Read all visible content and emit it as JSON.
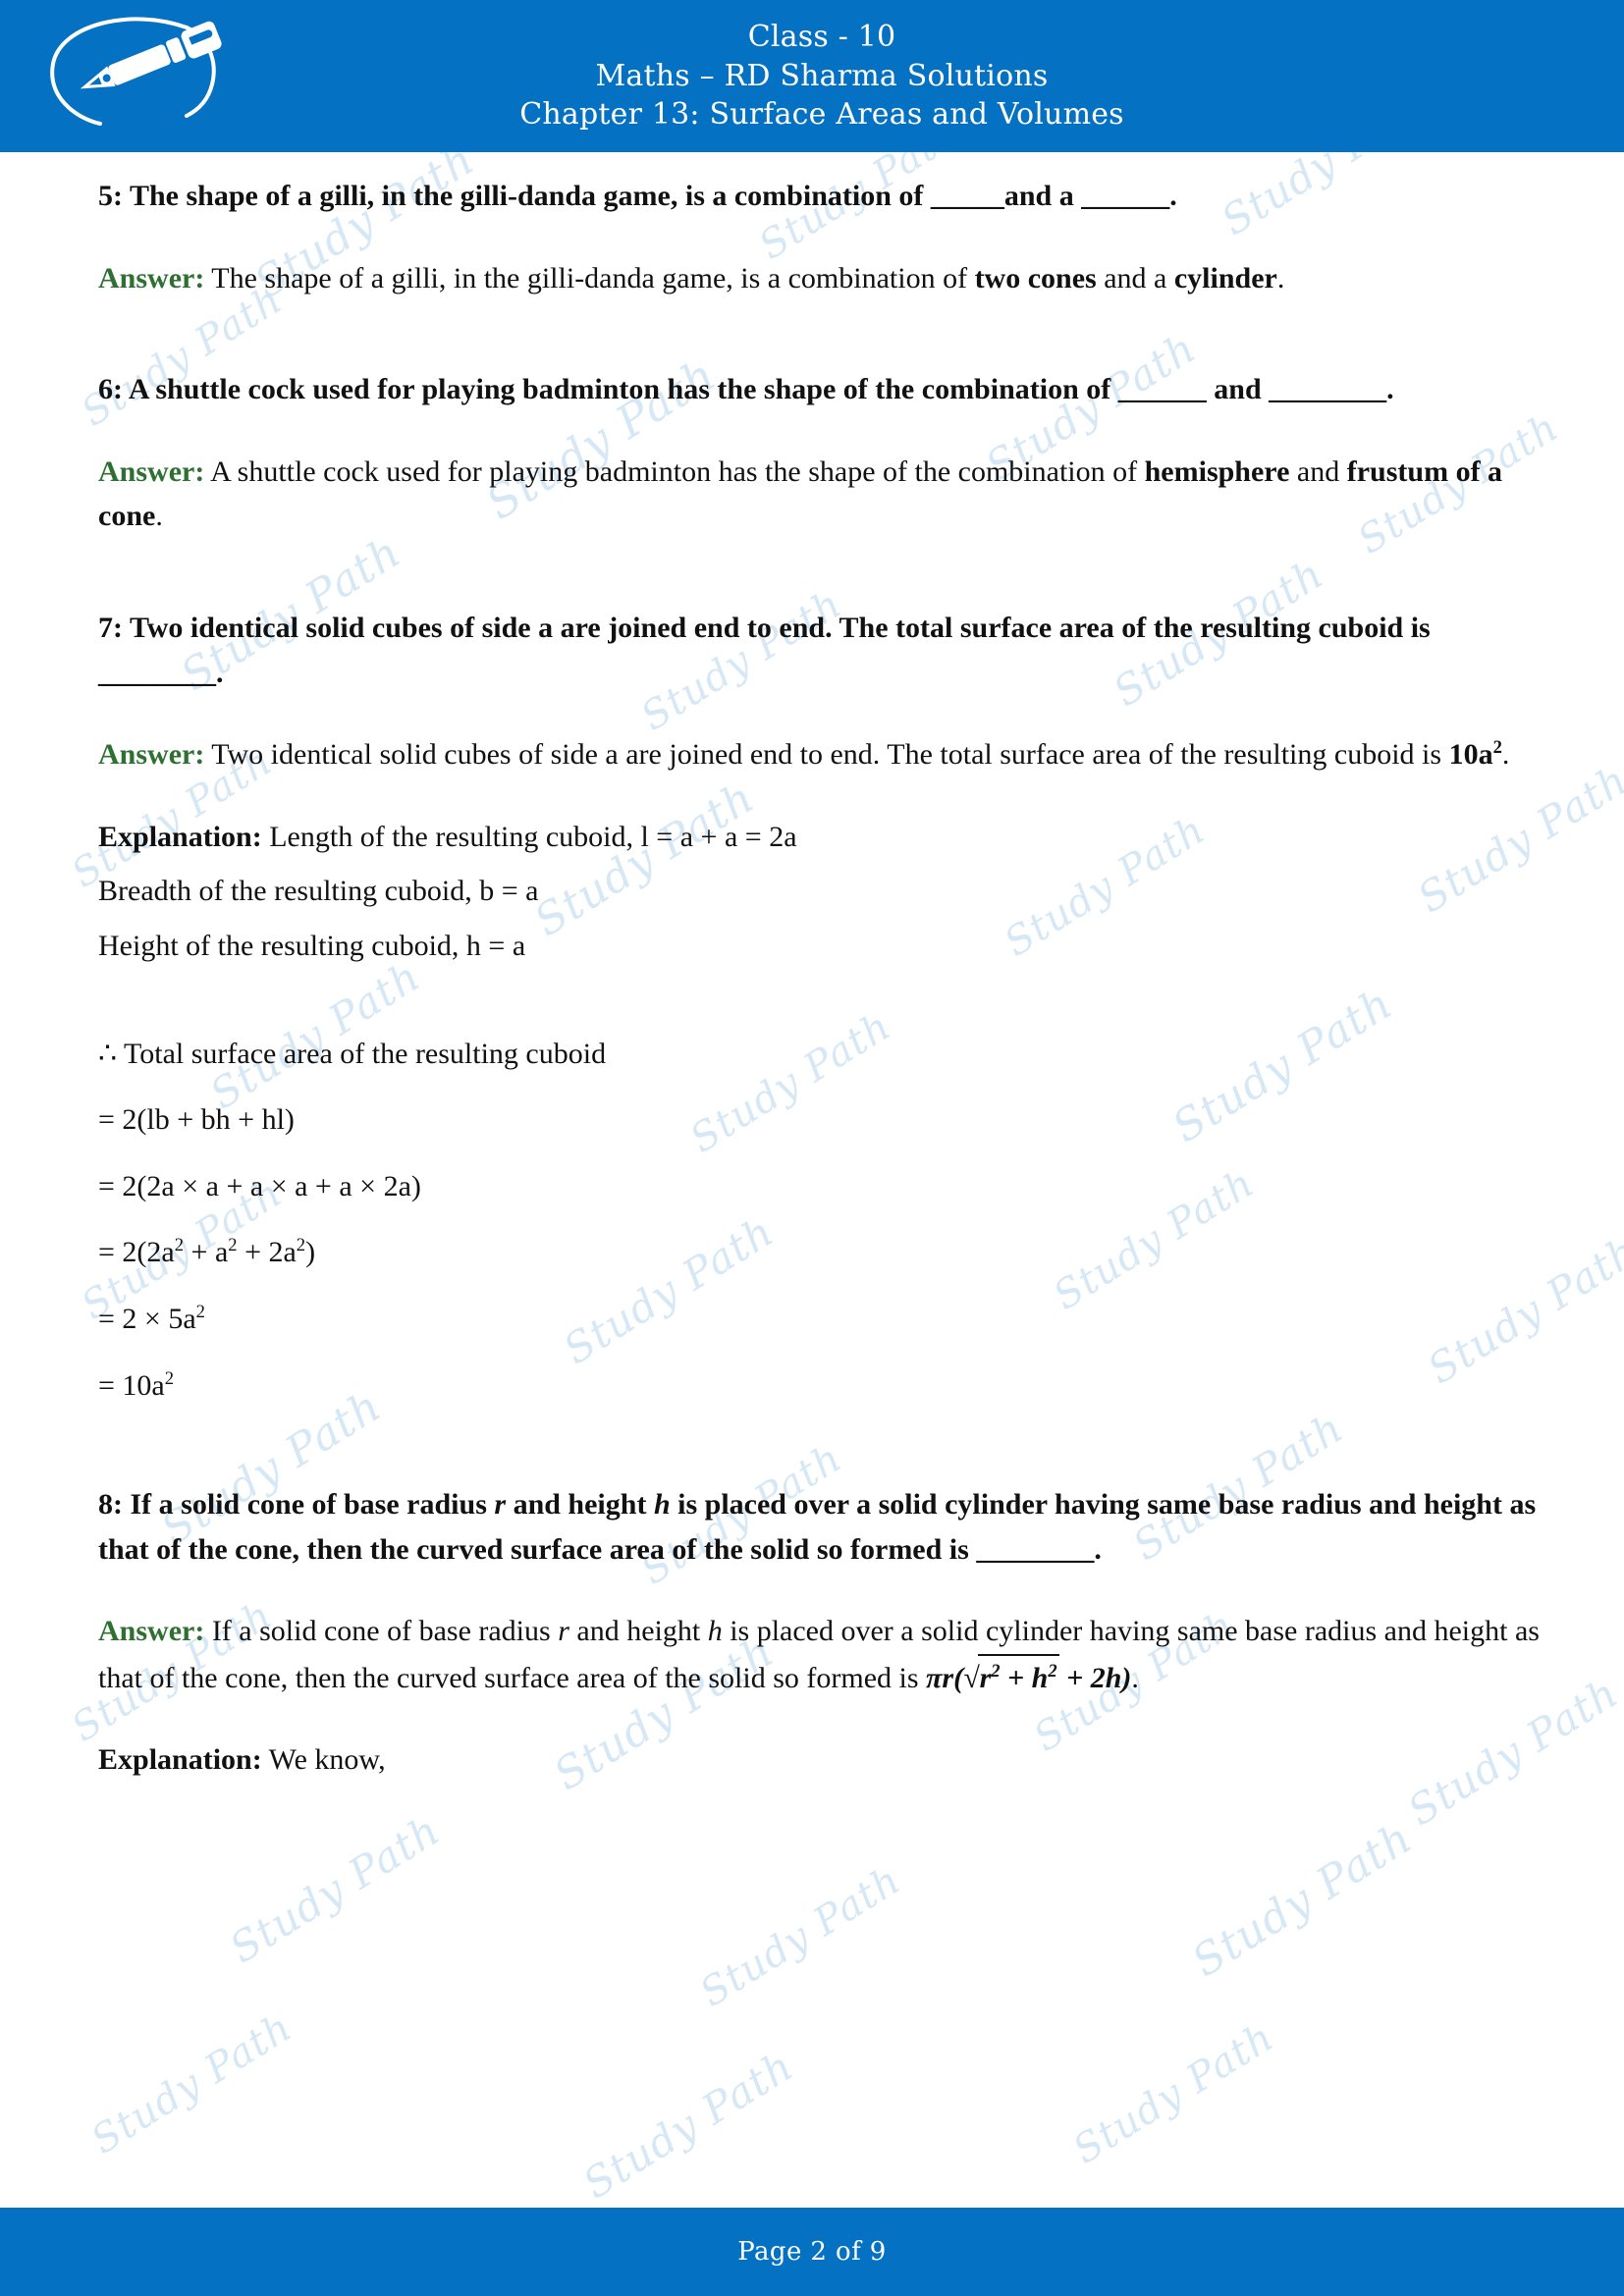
{
  "header": {
    "brand_name": "Study Path",
    "logo_icon": "fountain-pen-oval-logo",
    "line1": "Class - 10",
    "line2": "Maths – RD Sharma Solutions",
    "line3": "Chapter 13: Surface Areas and Volumes",
    "bar_color": "#0571C3"
  },
  "watermark": {
    "text": "Study Path",
    "color": "#cfe4f5"
  },
  "labels": {
    "answer": "Answer:",
    "explanation": "Explanation:"
  },
  "content": {
    "q5": {
      "number": "5:",
      "text": " The shape of a gilli, in the gilli-danda game, is a combination of _____and a ______."
    },
    "a5": {
      "pre": " The shape of a gilli, in the gilli-danda game, is a combination of ",
      "bold1": "two cones",
      "mid": " and a ",
      "bold2": "cylinder",
      "post": "."
    },
    "q6": {
      "number": "6:",
      "text": " A shuttle cock used for playing badminton has the shape of the combination of ______ and ________."
    },
    "a6": {
      "pre": " A shuttle cock used for playing badminton has the shape of the combination of ",
      "bold1": "hemisphere",
      "mid": " and ",
      "bold2": "frustum of a cone",
      "post": "."
    },
    "q7": {
      "number": "7:",
      "text": " Two identical solid cubes of side a are joined end to end. The total surface area of the resulting cuboid is ________."
    },
    "a7": {
      "pre": " Two identical solid cubes of side a are joined end to end. The total surface area of the resulting cuboid is ",
      "bold1": "10a",
      "bold1_sup": "2",
      "post": "."
    },
    "e7": {
      "line1": " Length of the resulting cuboid, l = a + a = 2a",
      "line2": "Breadth of the resulting cuboid, b = a",
      "line3": "Height of the resulting cuboid, h = a"
    },
    "eq7": {
      "intro": "∴ Total surface area of the resulting cuboid",
      "s1": "= 2(lb + bh + hl)",
      "s2": "= 2(2a × a + a × a + a × 2a)",
      "s3_pre": "= 2(2a",
      "s3_sup1": "2",
      "s3_mid1": " + a",
      "s3_sup2": "2",
      "s3_mid2": " + 2a",
      "s3_sup3": "2",
      "s3_post": ")",
      "s4_pre": "= 2 × 5a",
      "s4_sup": "2",
      "s5_pre": "= 10a",
      "s5_sup": "2"
    },
    "q8": {
      "number": "8:",
      "p1": " If a solid cone of base radius ",
      "var_r": "r",
      "p2": " and height ",
      "var_h": "h",
      "p3": " is placed over a solid cylinder having same base radius and height as that of the cone, then the curved surface area of the solid so formed is ________."
    },
    "a8": {
      "p1": " If a solid cone of base radius ",
      "var_r": "r",
      "p2": " and height ",
      "var_h": "h",
      "p3": " is placed over a solid cylinder having same base radius and height as that of the cone, then the curved surface area of the solid so formed is ",
      "f_pi": "πr",
      "f_open": "(",
      "f_radical": "√",
      "f_r": "r",
      "f_rsup": "2",
      "f_plus": " + ",
      "f_h": "h",
      "f_hsup": "2",
      "f_tail": " + 2h",
      "f_close": ")",
      "post": "."
    },
    "e8": {
      "text": " We know,"
    }
  },
  "footer": {
    "page_text": "Page 2 of 9",
    "bar_color": "#0571C3"
  }
}
